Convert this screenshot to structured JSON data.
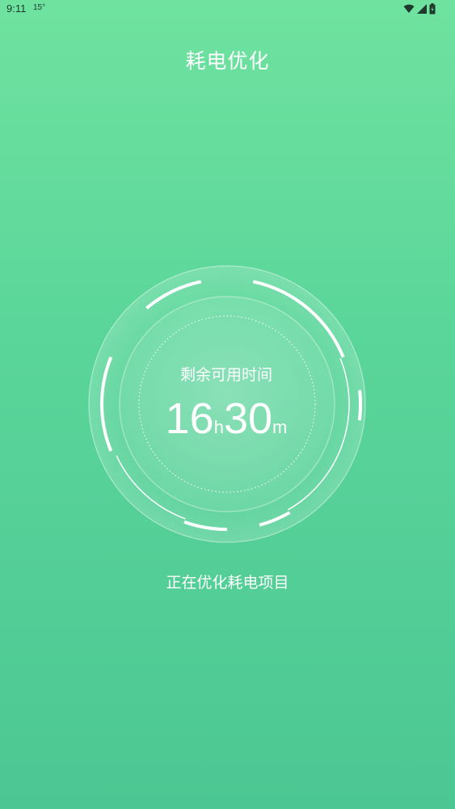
{
  "status_bar": {
    "time": "9:11",
    "temperature": "15°",
    "icons": [
      "wifi-icon",
      "cellular-signal-icon",
      "battery-icon"
    ]
  },
  "header": {
    "title": "耗电优化"
  },
  "dial": {
    "label": "剩余可用时间",
    "hours": "16",
    "hours_unit": "h",
    "minutes": "30",
    "minutes_unit": "m"
  },
  "status": {
    "text": "正在优化耗电项目"
  },
  "colors": {
    "background_top": "#6fe29f",
    "background_bottom": "#4cc793",
    "text": "#ffffff"
  }
}
